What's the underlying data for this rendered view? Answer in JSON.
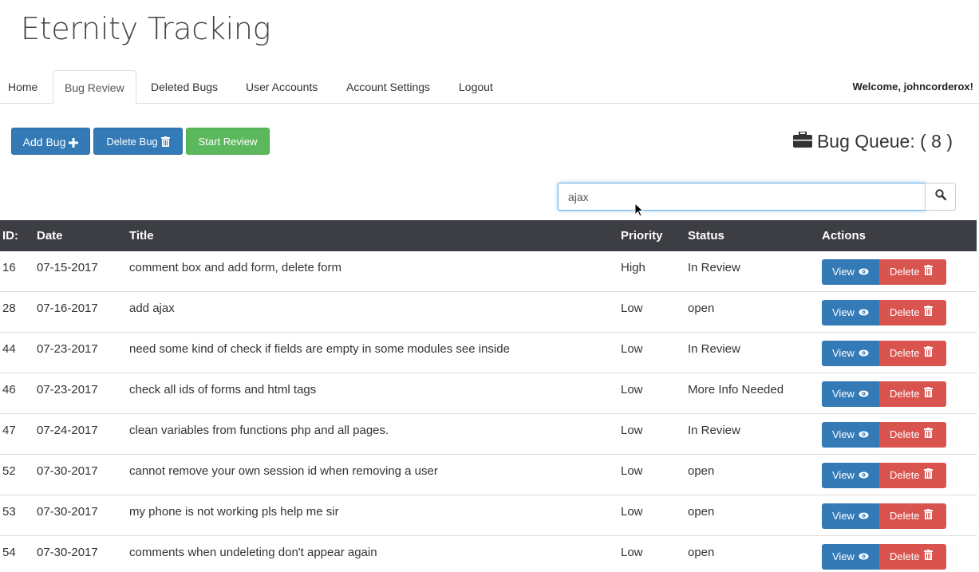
{
  "app": {
    "title": "Eternity Tracking"
  },
  "nav": {
    "tabs": [
      {
        "label": "Home"
      },
      {
        "label": "Bug Review",
        "active": true
      },
      {
        "label": "Deleted Bugs"
      },
      {
        "label": "User Accounts"
      },
      {
        "label": "Account Settings"
      },
      {
        "label": "Logout"
      }
    ],
    "welcome": "Welcome, johncorderox!"
  },
  "toolbar": {
    "add_label": "Add Bug",
    "delete_label": "Delete Bug",
    "review_label": "Start Review"
  },
  "queue": {
    "label": "Bug Queue: ( 8 )"
  },
  "search": {
    "value": "ajax",
    "icon": "search-icon"
  },
  "table": {
    "headers": {
      "id": "ID:",
      "date": "Date",
      "title": "Title",
      "priority": "Priority",
      "status": "Status",
      "actions": "Actions"
    },
    "rows": [
      {
        "id": "16",
        "date": "07-15-2017",
        "title": "comment box and add form, delete form",
        "priority": "High",
        "status": "In Review"
      },
      {
        "id": "28",
        "date": "07-16-2017",
        "title": "add ajax",
        "priority": "Low",
        "status": "open"
      },
      {
        "id": "44",
        "date": "07-23-2017",
        "title": "need some kind of check if fields are empty in some modules see inside",
        "priority": "Low",
        "status": "In Review"
      },
      {
        "id": "46",
        "date": "07-23-2017",
        "title": "check all ids of forms and html tags",
        "priority": "Low",
        "status": "More Info Needed"
      },
      {
        "id": "47",
        "date": "07-24-2017",
        "title": "clean variables from functions php and all pages.",
        "priority": "Low",
        "status": "In Review"
      },
      {
        "id": "52",
        "date": "07-30-2017",
        "title": "cannot remove your own session id when removing a user",
        "priority": "Low",
        "status": "open"
      },
      {
        "id": "53",
        "date": "07-30-2017",
        "title": "my phone is not working pls help me sir",
        "priority": "Low",
        "status": "open"
      },
      {
        "id": "54",
        "date": "07-30-2017",
        "title": "comments when undeleting don't appear again",
        "priority": "Low",
        "status": "open"
      }
    ],
    "view_label": "View",
    "delete_label": "Delete"
  },
  "colors": {
    "primary": "#337ab7",
    "success": "#5cb85c",
    "danger": "#d9534f",
    "table_header": "#3c3e44"
  }
}
